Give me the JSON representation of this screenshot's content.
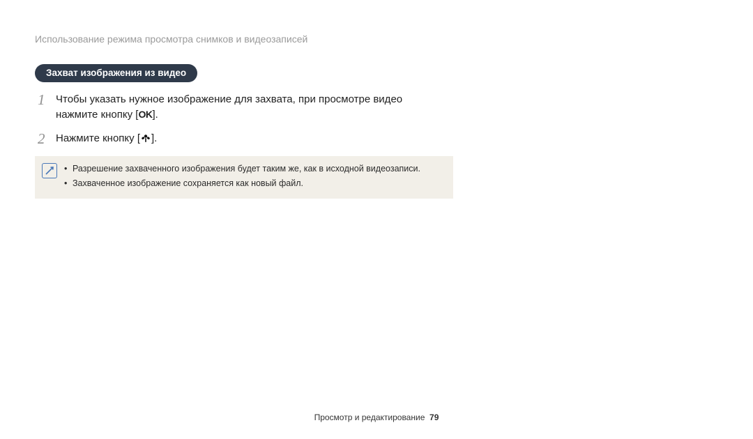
{
  "breadcrumb": "Использование режима просмотра снимков и видеозаписей",
  "section_pill": "Захват изображения из видео",
  "steps": [
    {
      "num": "1",
      "text_before": "Чтобы указать нужное изображение для захвата, при просмотре видео нажмите кнопку [",
      "key": "OK",
      "text_after": "]."
    },
    {
      "num": "2",
      "text_before": "Нажмите кнопку [",
      "icon": "macro",
      "text_after": "]."
    }
  ],
  "notes": [
    "Разрешение захваченного изображения будет таким же, как в исходной видеозаписи.",
    "Захваченное изображение сохраняется как новый файл."
  ],
  "footer": {
    "label": "Просмотр и редактирование",
    "page": "79"
  }
}
